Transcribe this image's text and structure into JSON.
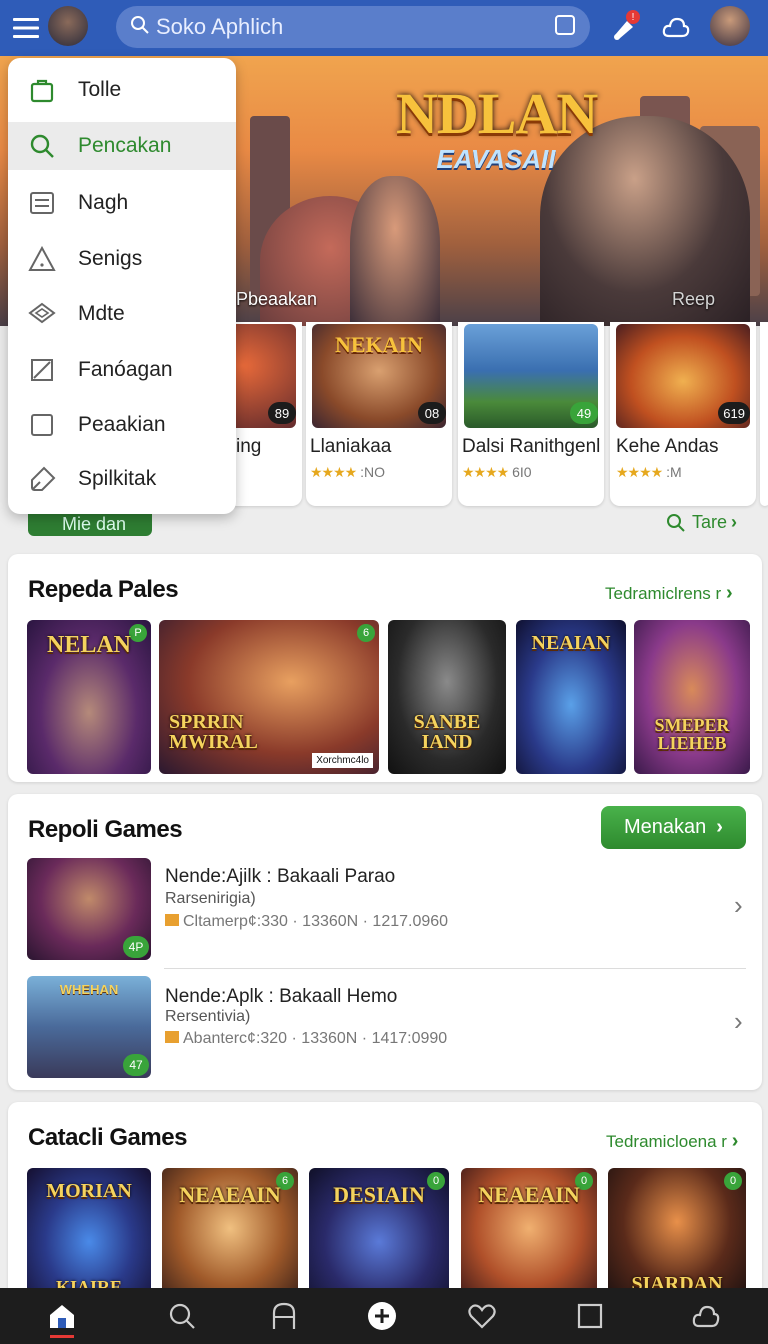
{
  "search": {
    "placeholder": "Soko Aphlich"
  },
  "topbar": {
    "notification_count": "!"
  },
  "hero": {
    "logo_top": "NDLAN",
    "logo_bottom": "EAVASAII",
    "caption_left": "Pbeaakan",
    "caption_right": "Reep"
  },
  "drawer": {
    "items": [
      {
        "label": "Tolle",
        "icon": "bag-icon"
      },
      {
        "label": "Pencakan",
        "icon": "search-icon",
        "selected": true
      },
      {
        "label": "Nagh",
        "icon": "list-icon"
      },
      {
        "label": "Senigs",
        "icon": "warning-icon"
      },
      {
        "label": "Mdte",
        "icon": "layers-icon"
      },
      {
        "label": "Fanóagan",
        "icon": "square-slash-icon"
      },
      {
        "label": "Peaakian",
        "icon": "square-icon"
      },
      {
        "label": "Spilkitak",
        "icon": "tag-icon"
      }
    ]
  },
  "game_row": {
    "cards": [
      {
        "name": "ing",
        "rating": "",
        "badge": "89"
      },
      {
        "name": "Llaniakaa",
        "stars": "★★★★",
        "rating": ":NO",
        "badge": "08",
        "art": "NEKAIN"
      },
      {
        "name": "Dalsi Ranithgenl",
        "stars": "★★★★",
        "rating": "6I0",
        "badge": "49"
      },
      {
        "name": "Kehe Andas",
        "stars": "★★★★",
        "rating": ":M",
        "badge": "619"
      }
    ],
    "more_button": "Mie dan",
    "tare_link": "Tare"
  },
  "section1": {
    "title": "Repeda Pales",
    "link": "Tedramiclrens r",
    "tiles": [
      {
        "title": "NELAN",
        "badge": "P"
      },
      {
        "title": "SPRRIN MWIRAL",
        "caption": "Xorchmc4lo",
        "badge": "6"
      },
      {
        "title": "SANBE IAND"
      },
      {
        "title": "NEAIAN"
      },
      {
        "title": "SMEPER LIEHEB"
      }
    ]
  },
  "section2": {
    "title": "Repoli Games",
    "button": "Menakan",
    "items": [
      {
        "title": "Nende:Ajilk : Bakaali Parao",
        "subtitle": "Rarsenirigia)",
        "meta": "Cltamerp¢:330 · 13360N · 1217.0960",
        "badge": "4P"
      },
      {
        "title": "Nende:Aplk : Bakaall Hemo",
        "subtitle": "Rersentivia)",
        "meta": "Abanterc¢:320 · 13360N · 1417:0990",
        "badge": "47",
        "art": "WHEHAN"
      }
    ]
  },
  "section3": {
    "title": "Catacli Games",
    "link": "Tedramicloena r",
    "tiles": [
      {
        "title": "MORIAN",
        "subtitle": "KIAIRE"
      },
      {
        "title": "NEAEAIN",
        "badge": "6"
      },
      {
        "title": "DESIAIN",
        "badge": "0"
      },
      {
        "title": "NEAEAIN",
        "badge": "0"
      },
      {
        "title": "SIARDAN",
        "badge": "0"
      }
    ]
  },
  "bottom_nav": {
    "items": [
      "home-icon",
      "search-icon",
      "arch-icon",
      "plus-circle-icon",
      "heart-icon",
      "square-icon",
      "cloud-icon"
    ]
  },
  "colors": {
    "topbar": "#2f5cb8",
    "accent": "#2e8a2e",
    "nav": "#1d1d1d"
  }
}
